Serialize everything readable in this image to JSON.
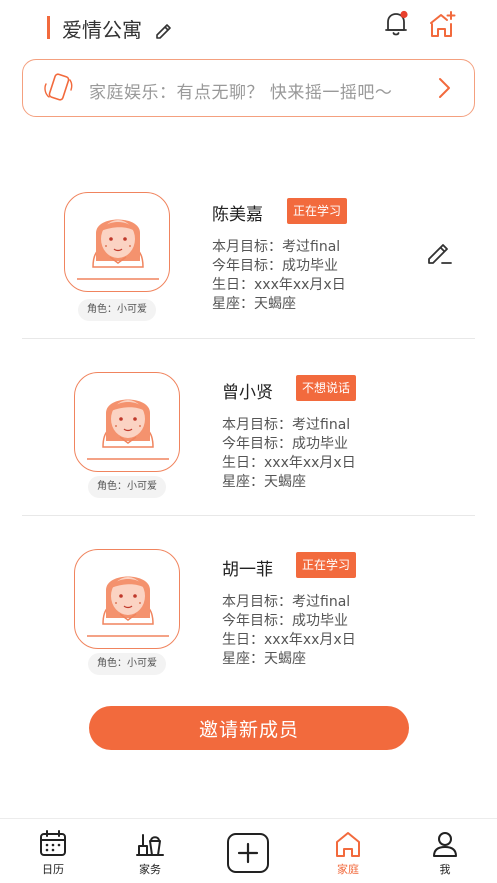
{
  "header": {
    "title": "爱情公寓",
    "icons": [
      "edit-icon",
      "bell-icon",
      "home-add-icon"
    ]
  },
  "banner": {
    "text": "家庭娱乐：有点无聊？ 快来摇一摇吧～",
    "icons": [
      "phone-shake-icon",
      "chevron-right-icon"
    ]
  },
  "members": [
    {
      "name": "陈美嘉",
      "status": "正在学习",
      "monthly_goal": "本月目标：考过final",
      "yearly_goal": "今年目标：成功毕业",
      "birthday": "生日：xxx年xx月x日",
      "constellation": "星座：天蝎座",
      "role": "角色：小可爱"
    },
    {
      "name": "曾小贤",
      "status": "不想说话",
      "monthly_goal": "本月目标：考过final",
      "yearly_goal": "今年目标：成功毕业",
      "birthday": "生日：xxx年xx月x日",
      "constellation": "星座：天蝎座",
      "role": "角色：小可爱"
    },
    {
      "name": "胡一菲",
      "status": "正在学习",
      "monthly_goal": "本月目标：考过final",
      "yearly_goal": "今年目标：成功毕业",
      "birthday": "生日：xxx年xx月x日",
      "constellation": "星座：天蝎座",
      "role": "角色：小可爱"
    }
  ],
  "invite_button": "邀请新成员",
  "tabbar": {
    "calendar": "日历",
    "chores": "家务",
    "home": "家庭",
    "me": "我",
    "active": "home"
  },
  "colors": {
    "accent": "#f26a3d",
    "accent_light": "#f4a07f",
    "text": "#333333",
    "muted": "#999999"
  }
}
